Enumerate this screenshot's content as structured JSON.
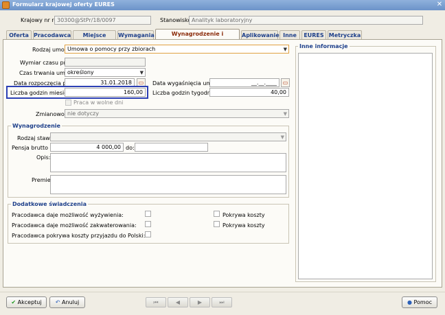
{
  "window": {
    "title": "Formularz krajowej oferty EURES"
  },
  "header": {
    "ref_label": "Krajowy nr ref:",
    "ref_value": "30300@StPr/18/0097",
    "position_label": "Stanowisko:",
    "position_value": "Analityk laboratoryjny"
  },
  "tabs": [
    {
      "label": "Oferta"
    },
    {
      "label": "Pracodawca"
    },
    {
      "label": "Miejsce pracy"
    },
    {
      "label": "Wymagania"
    },
    {
      "label": "Wynagrodzenie i zatrudnienie"
    },
    {
      "label": "Aplikowanie"
    },
    {
      "label": "Inne"
    },
    {
      "label": "EURES"
    },
    {
      "label": "Metryczka"
    }
  ],
  "employment": {
    "contract_type_label": "Rodzaj umowy:",
    "contract_type_value": "Umowa o pomocy przy zbiorach",
    "work_time_label": "Wymiar czasu pracy:",
    "work_time_value": "",
    "duration_label": "Czas trwania umowy:",
    "duration_value": "określony",
    "start_date_label": "Data rozpoczęcia pracy:",
    "start_date_value": "31.01.2018",
    "end_date_label": "Data wygaśnięcia umowy:",
    "end_date_value": "__.__.____",
    "monthly_hours_label": "Liczba godzin miesięcznie:",
    "monthly_hours_value": "160,00",
    "weekly_hours_label": "Liczba godzin tygodniowo:",
    "weekly_hours_value": "40,00",
    "weekend_work_label": "Praca w wolne dni",
    "shift_label": "Zmianowość:",
    "shift_value": "nie dotyczy"
  },
  "salary": {
    "title": "Wynagrodzenie",
    "rate_type_label": "Rodzaj stawki:",
    "rate_type_value": "",
    "gross_from_label": "Pensja brutto od:",
    "gross_from_value": "4 000,00",
    "gross_to_label": "do:",
    "gross_to_value": "",
    "description_label": "Opis:",
    "bonuses_label": "Premie:"
  },
  "benefits": {
    "title": "Dodatkowe świadczenia",
    "rows": [
      {
        "label": "Pracodawca daje możliwość wyżywienia:",
        "cost_label": "Pokrywa koszty"
      },
      {
        "label": "Pracodawca daje możliwość zakwaterowania:",
        "cost_label": "Pokrywa koszty"
      },
      {
        "label": "Pracodawca pokrywa koszty przyjazdu do Polski:"
      }
    ]
  },
  "other_info": {
    "title": "Inne informacje"
  },
  "footer": {
    "accept_label": "Akceptuj",
    "cancel_label": "Anuluj",
    "help_label": "Pomoc",
    "nav": [
      "⏮",
      "◀",
      "▶",
      "⏭"
    ]
  },
  "colors": {
    "accent": "#1d3f8a",
    "active_tab": "#8a2a0a",
    "highlight": "#2b3fb5",
    "dropdown_border": "#e0a040"
  }
}
